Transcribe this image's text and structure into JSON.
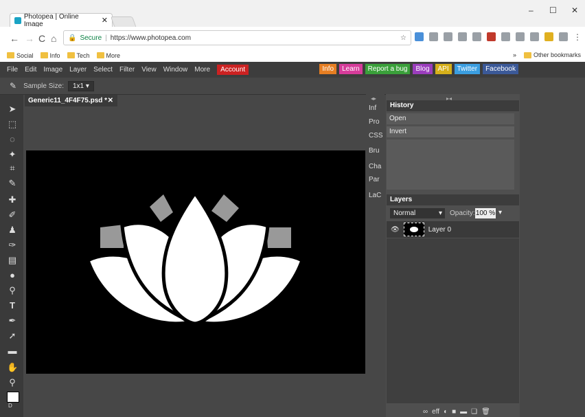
{
  "browser": {
    "tab_title": "Photopea | Online Image",
    "tab_close": "✕",
    "window_controls": [
      "–",
      "☐",
      "✕"
    ],
    "nav": [
      "←",
      "→",
      "C",
      "⌂"
    ],
    "secure_label": "Secure",
    "url": "https://www.photopea.com",
    "bookmarks": [
      "Social",
      "Info",
      "Tech",
      "More"
    ],
    "other_bookmarks": "Other bookmarks",
    "overflow": "»",
    "menu_dots": "⋮"
  },
  "app": {
    "menu": [
      "File",
      "Edit",
      "Image",
      "Layer",
      "Select",
      "Filter",
      "View",
      "Window",
      "More"
    ],
    "account": "Account",
    "site_links": [
      {
        "label": "Info",
        "color": "#e67e22"
      },
      {
        "label": "Learn",
        "color": "#d63c9a"
      },
      {
        "label": "Report a bug",
        "color": "#3aa03a"
      },
      {
        "label": "Blog",
        "color": "#9b3dbd"
      },
      {
        "label": "API",
        "color": "#d6b01a"
      },
      {
        "label": "Twitter",
        "color": "#3b9ee0"
      },
      {
        "label": "Facebook",
        "color": "#3b5998"
      }
    ],
    "options": {
      "sample_size_label": "Sample Size:",
      "sample_size_value": "1x1"
    },
    "document_tab": {
      "name": "Generic11_4F4F75.psd *",
      "close": "✕"
    },
    "side_tabs": [
      "Inf",
      "Pro",
      "CSS",
      "Bru",
      "Cha",
      "Par",
      "LaC"
    ],
    "history": {
      "title": "History",
      "items": [
        "Open",
        "Invert"
      ]
    },
    "layers": {
      "title": "Layers",
      "blend_mode": "Normal",
      "opacity_label": "Opacity:",
      "opacity_value": "100 %",
      "layer_name": "Layer 0",
      "visibility_icon": "eye-icon"
    },
    "layer_buttons": [
      "∞",
      "eff",
      "◐",
      "■",
      "▬",
      "❏",
      "🗑"
    ]
  }
}
